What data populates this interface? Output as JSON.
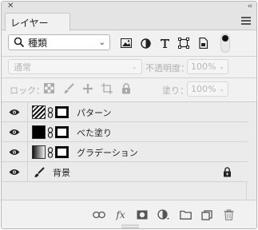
{
  "tab": {
    "label": "レイヤー",
    "close": "×"
  },
  "top": {
    "close": "✕",
    "collapse": "‹‹"
  },
  "filter": {
    "kind_label": "種類",
    "icons": [
      "pixel-filter-icon",
      "adjustment-filter-icon",
      "type-filter-icon",
      "shape-filter-icon",
      "smart-object-filter-icon"
    ]
  },
  "blend": {
    "mode": "通常",
    "opacity_label": "不透明度：",
    "opacity_value": "100%"
  },
  "lock": {
    "label": "ロック：",
    "fill_label": "塗り：",
    "fill_value": "100%"
  },
  "layers": [
    {
      "name": "パターン",
      "thumb": "pattern",
      "type": "fill",
      "visible": true
    },
    {
      "name": "べた塗り",
      "thumb": "black",
      "type": "fill",
      "visible": true
    },
    {
      "name": "グラデーション",
      "thumb": "gradient",
      "type": "fill",
      "visible": true
    },
    {
      "name": "背景",
      "thumb": "none",
      "type": "background",
      "visible": true,
      "locked": true
    }
  ],
  "bottom_tools": [
    "link-layers-icon",
    "fx-icon",
    "add-mask-icon",
    "new-adjustment-icon",
    "new-group-icon",
    "new-layer-icon",
    "trash-icon"
  ],
  "bottom_fx": "fx"
}
